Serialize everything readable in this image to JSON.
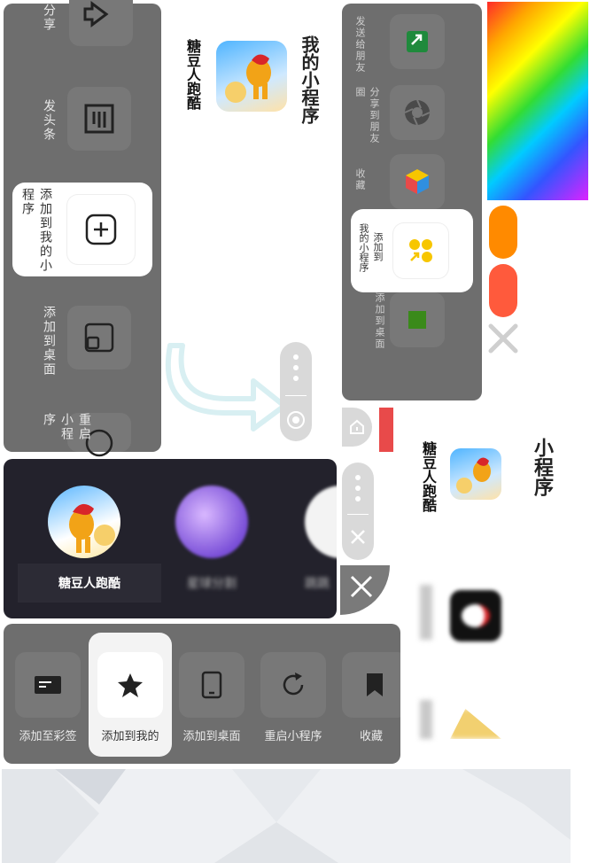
{
  "left_panel": {
    "items": [
      {
        "label": "分享"
      },
      {
        "label": "发头条"
      },
      {
        "label": "添加到我的小程序"
      },
      {
        "label": "添加到桌面"
      },
      {
        "label": "重启小程序"
      }
    ]
  },
  "mini_card_top": {
    "header": "我的小程序",
    "app_name": "糖豆人跑酷"
  },
  "right_panel": {
    "items": [
      {
        "label": "发送给朋友"
      },
      {
        "label": "分享到朋友圈"
      },
      {
        "label": "收藏"
      },
      {
        "label": "添加到我的小程序"
      },
      {
        "label": "添加到桌面"
      }
    ],
    "highlight_line1": "添加到",
    "highlight_line2": "我的小程序"
  },
  "mini_list_right": {
    "header": "小程序",
    "app_name": "糖豆人跑酷"
  },
  "app_strip": {
    "items": [
      {
        "label": "糖豆人跑酷"
      },
      {
        "label": "星球分割"
      },
      {
        "label": "跳跳"
      }
    ]
  },
  "bottom_menu": {
    "items": [
      {
        "label": "添加至彩签"
      },
      {
        "label": "添加到我的"
      },
      {
        "label": "添加到桌面"
      },
      {
        "label": "重启小程序"
      },
      {
        "label": "收藏"
      }
    ]
  },
  "colors": {
    "panel_gray": "#6e6e6e",
    "tile_gray": "#787878",
    "orange": "#ff8a00",
    "red_orange": "#ff5a3c",
    "red": "#e84a4a",
    "yellow": "#f7c600",
    "green": "#1f8a3c"
  }
}
